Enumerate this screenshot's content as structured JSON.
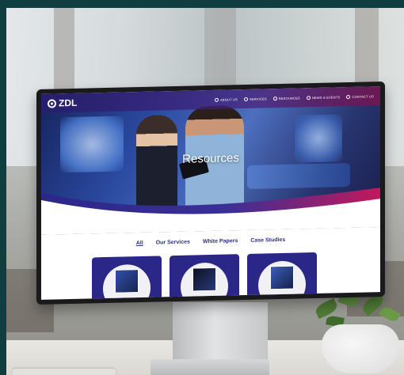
{
  "website": {
    "brand": "ZDL",
    "nav": [
      "ABOUT US",
      "SERVICES",
      "RESOURCES",
      "NEWS & EVENTS",
      "CONTACT US"
    ],
    "hero_title": "Resources",
    "filters": [
      "All",
      "Our Services",
      "White Papers",
      "Case Studies"
    ],
    "active_filter": "All"
  },
  "colors": {
    "frame": "#0f3d40",
    "hero_primary": "#2a4aa0",
    "accent_magenta": "#c2185b",
    "card_blue": "#2b2789",
    "filter_text": "#2b2f85"
  }
}
